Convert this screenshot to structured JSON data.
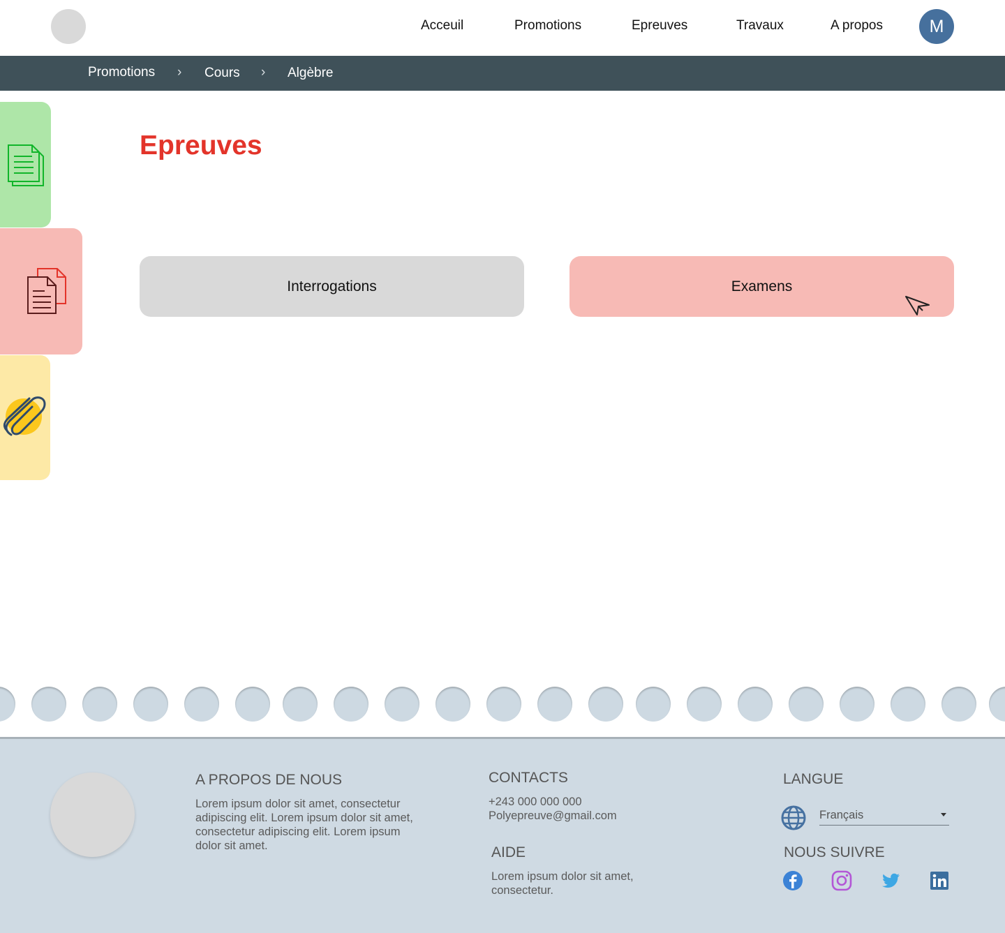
{
  "nav": {
    "items": [
      "Acceuil",
      "Promotions",
      "Epreuves",
      "Travaux",
      "A propos"
    ],
    "avatar_initial": "M"
  },
  "breadcrumb": [
    "Promotions",
    "Cours",
    "Algèbre"
  ],
  "side_tabs": [
    {
      "icon": "documents-icon",
      "color": "#aee6a8"
    },
    {
      "icon": "file-copy-icon",
      "color": "#f7bab5"
    },
    {
      "icon": "paperclip-icon",
      "color": "#fde9a6"
    }
  ],
  "page": {
    "title": "Epreuves",
    "cards": [
      {
        "label": "Interrogations",
        "color": "#d9d9d9"
      },
      {
        "label": "Examens",
        "color": "#f7bab5"
      }
    ]
  },
  "footer": {
    "about": {
      "heading": "A PROPOS DE NOUS",
      "text": "Lorem ipsum dolor sit amet, consectetur adipiscing elit. Lorem ipsum dolor sit amet, consectetur adipiscing elit. Lorem ipsum dolor sit amet."
    },
    "contacts": {
      "heading": "CONTACTS",
      "phone": "+243 000 000 000",
      "email": "Polyepreuve@gmail.com"
    },
    "help": {
      "heading": "AIDE",
      "text": "Lorem ipsum dolor sit amet, consectetur."
    },
    "language": {
      "heading": "LANGUE",
      "selected": "Français"
    },
    "follow": {
      "heading": "NOUS SUIVRE",
      "networks": [
        "facebook-icon",
        "instagram-icon",
        "twitter-icon",
        "linkedin-icon"
      ]
    }
  },
  "colors": {
    "title_red": "#e3342a",
    "breadcrumb_bar": "#3f5159",
    "avatar_blue": "#46709d",
    "footer_bg": "#cfdae3"
  }
}
